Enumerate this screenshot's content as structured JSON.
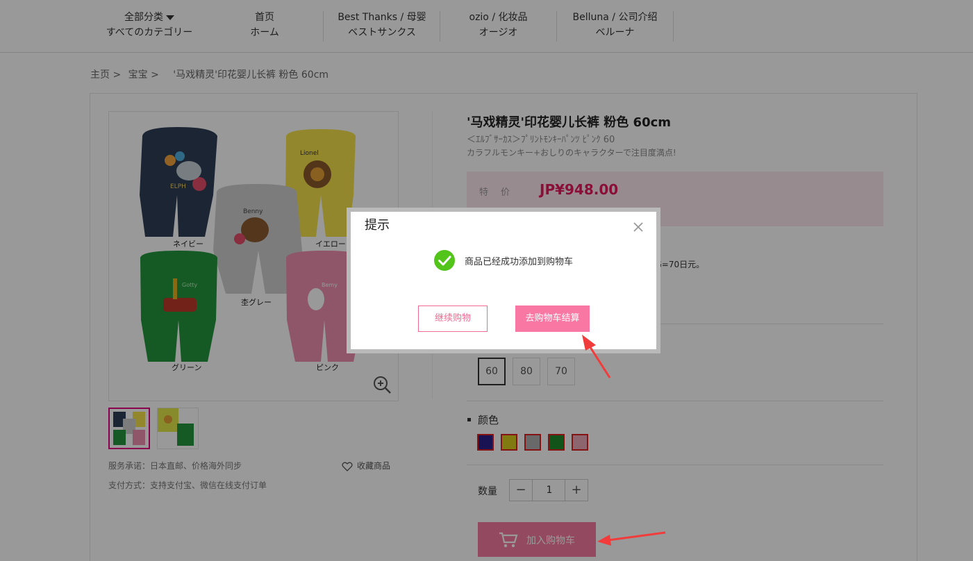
{
  "nav": {
    "items": [
      {
        "zh": "全部分类",
        "jp": "すべてのカテゴリー"
      },
      {
        "zh": "首页",
        "jp": "ホーム"
      },
      {
        "zh": "Best Thanks / 母婴",
        "jp": "ベストサンクス"
      },
      {
        "zh": "ozio / 化妆品",
        "jp": "オージオ"
      },
      {
        "zh": "Belluna / 公司介绍",
        "jp": "ベルーナ"
      }
    ]
  },
  "breadcrumb": {
    "home": "主页 >",
    "category": "宝宝 >",
    "current": "'马戏精灵'印花婴儿长裤 粉色 60cm"
  },
  "product": {
    "title": "'马戏精灵'印花婴儿长裤 粉色 60cm",
    "subtitle_jp": "＜ｴﾙﾌﾞｻｰｶｽ＞ﾌﾟﾘﾝﾄﾓﾝｷｰﾊﾟﾝﾂ ﾋﾟﾝｸ 60",
    "tagline_jp": "カラフルモンキー+おしりのキャラクターで注目度満点!",
    "price_label": "特价",
    "price": "JP¥948.00",
    "shipping_note": "1KG=70日元。",
    "image_labels": {
      "navy": "ネイビー",
      "yellow": "イエロー",
      "gray": "杢グレー",
      "green": "グリーン",
      "pink": "ピンク",
      "elph": "ELPH",
      "lionel": "Lionel",
      "benny": "Benny",
      "gotty": "Gotty",
      "bemy": "Bemy"
    },
    "service": "服务承诺：日本直邮、价格海外同步",
    "payment": "支付方式：支持支付宝、微信在线支付订单",
    "favorite": "收藏商品",
    "sizes": [
      "60",
      "80",
      "70"
    ],
    "color_label": "颜色",
    "colors": [
      "#2b1f8a",
      "#d6cc1c",
      "#b0b0b0",
      "#1f8a2b",
      "#eaa8b8"
    ],
    "qty_label": "数量",
    "qty": "1",
    "qty_minus": "−",
    "qty_plus": "+",
    "add_to_cart": "加入购物车"
  },
  "modal": {
    "title": "提示",
    "message": "商品已经成功添加到购物车",
    "continue": "继续购物",
    "checkout": "去购物车结算"
  }
}
